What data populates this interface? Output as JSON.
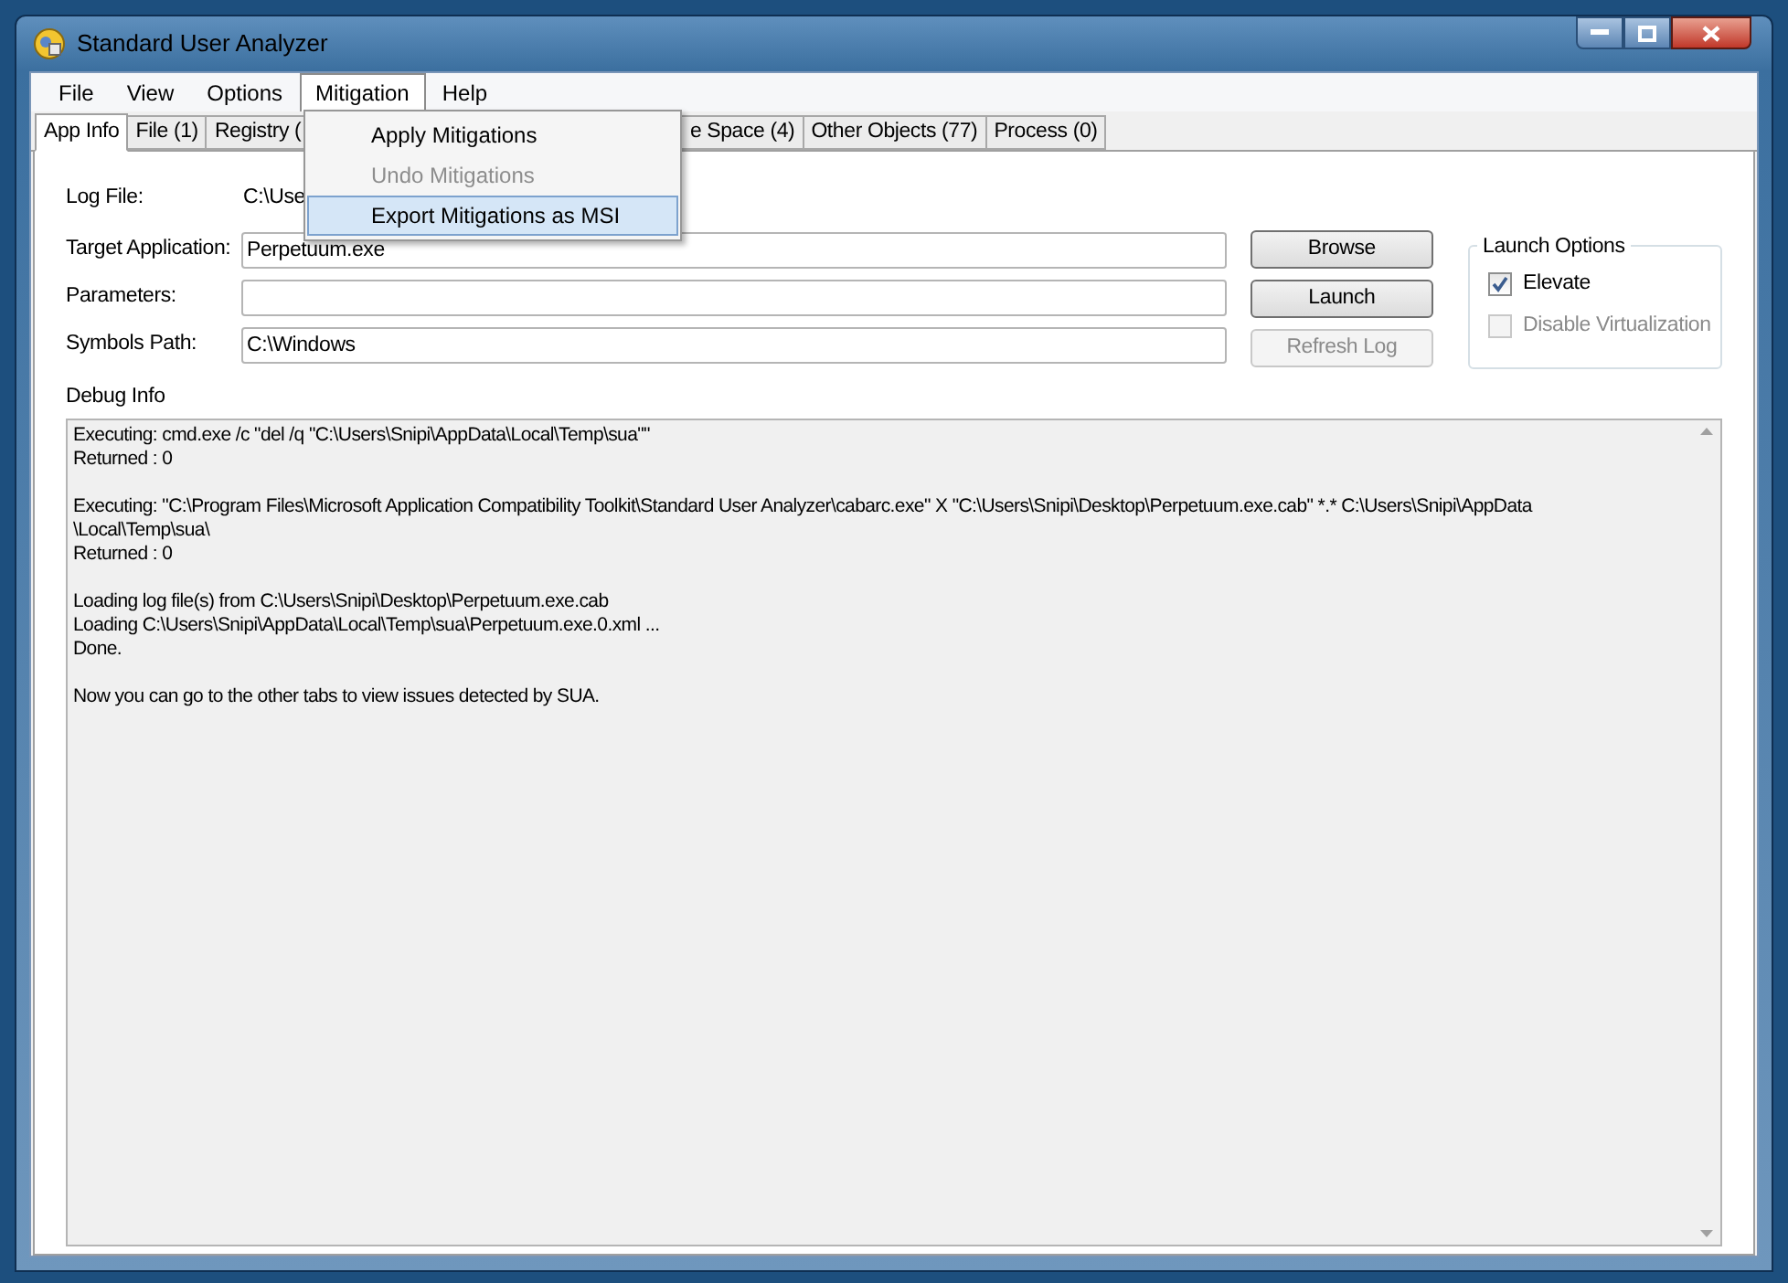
{
  "window": {
    "title": "Standard User Analyzer"
  },
  "menu_bar": [
    {
      "label": "File",
      "selected": false
    },
    {
      "label": "View",
      "selected": false
    },
    {
      "label": "Options",
      "selected": false
    },
    {
      "label": "Mitigation",
      "selected": true
    },
    {
      "label": "Help",
      "selected": false
    }
  ],
  "menu_dropdown": [
    {
      "label": "Apply Mitigations",
      "disabled": false,
      "selected": false
    },
    {
      "label": "Undo Mitigations",
      "disabled": true,
      "selected": false
    },
    {
      "label": "Export Mitigations as MSI",
      "disabled": false,
      "selected": true
    }
  ],
  "tabs": [
    {
      "label": "App Info",
      "selected": true
    },
    {
      "label": "File (1)",
      "selected": false
    },
    {
      "label": "Registry (",
      "selected": false
    },
    {
      "label": "e Space (4)",
      "selected": false
    },
    {
      "label": "Other Objects (77)",
      "selected": false
    },
    {
      "label": "Process (0)",
      "selected": false
    }
  ],
  "fields": [
    {
      "label": "Log File:",
      "value": "C:\\Use",
      "kind": "text"
    },
    {
      "label": "Target Application:",
      "value": "Perpetuum.exe",
      "kind": "input"
    },
    {
      "label": "Parameters:",
      "kind": "input"
    },
    {
      "label": "Symbols Path:",
      "value": "C:\\Windows",
      "kind": "input"
    }
  ],
  "buttons": [
    {
      "label": "Browse",
      "disabled": false
    },
    {
      "label": "Launch",
      "disabled": false
    },
    {
      "label": "Refresh Log",
      "disabled": true
    }
  ],
  "launch_options": {
    "title": "Launch Options",
    "options": [
      {
        "label": "Elevate",
        "checked": true,
        "disabled": false
      },
      {
        "label": "Disable Virtualization",
        "checked": false,
        "disabled": true
      }
    ]
  },
  "debug_info": {
    "label": "Debug Info",
    "paragraphs": [
      [
        "Executing: cmd.exe /c \"del /q \"C:\\Users\\Snipi\\AppData\\Local\\Temp\\sua\"\"",
        "Returned : 0"
      ],
      [
        "Executing: \"C:\\Program Files\\Microsoft Application Compatibility Toolkit\\Standard User Analyzer\\cabarc.exe\" X \"C:\\Users\\Snipi\\Desktop\\Perpetuum.exe.cab\" *.* C:\\Users\\Snipi\\AppData",
        "\\Local\\Temp\\sua\\",
        "Returned : 0"
      ],
      [
        "Loading log file(s) from C:\\Users\\Snipi\\Desktop\\Perpetuum.exe.cab",
        "Loading C:\\Users\\Snipi\\AppData\\Local\\Temp\\sua\\Perpetuum.exe.0.xml ...",
        "Done."
      ],
      [
        "Now you can go to the other tabs to view issues detected by SUA."
      ]
    ]
  }
}
